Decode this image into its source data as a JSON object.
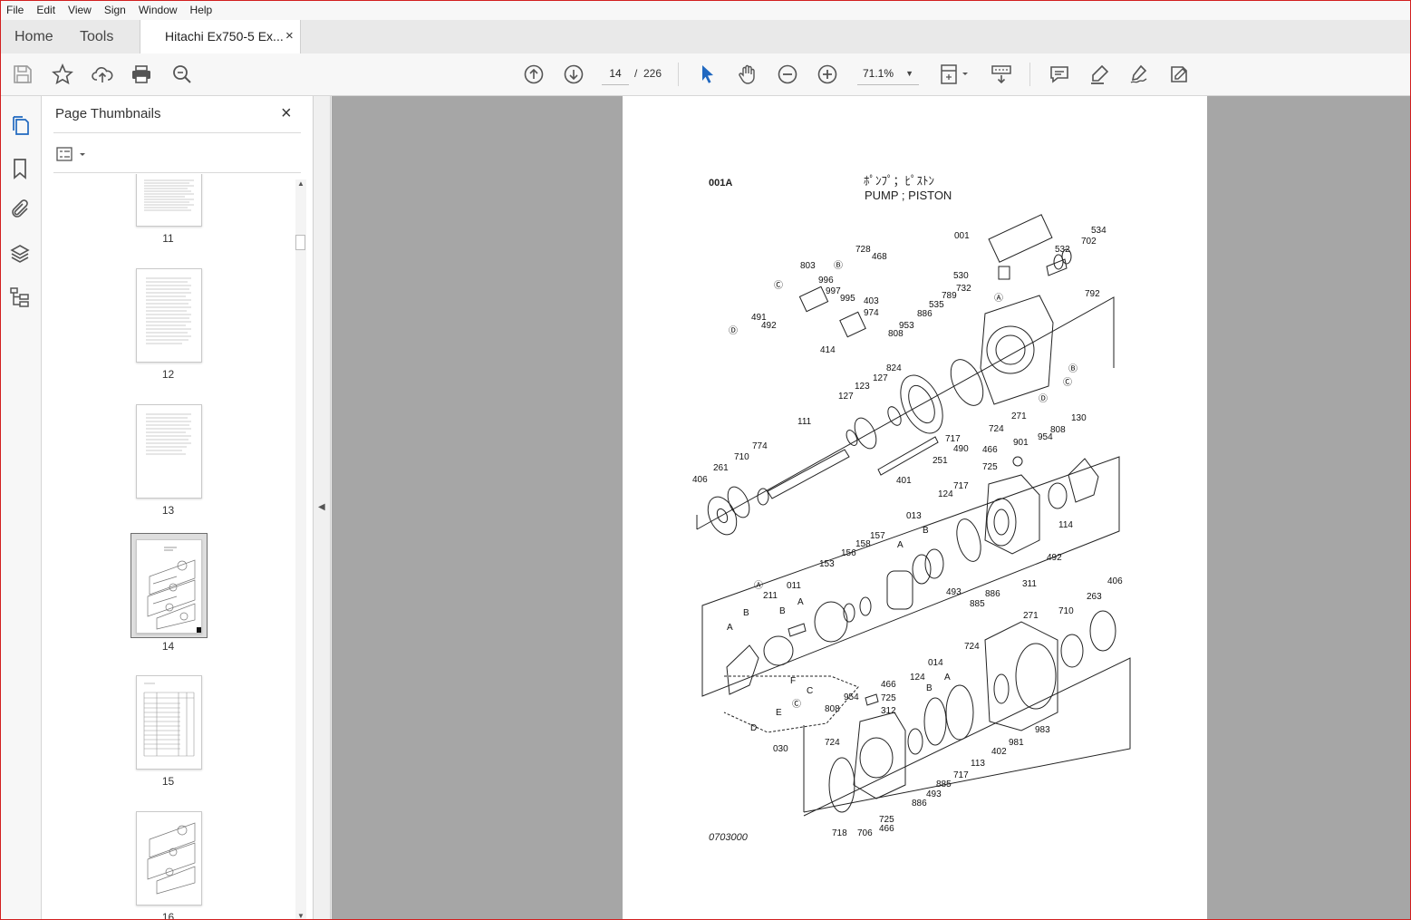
{
  "menu": [
    "File",
    "Edit",
    "View",
    "Sign",
    "Window",
    "Help"
  ],
  "tabs": {
    "home": "Home",
    "tools": "Tools",
    "document": "Hitachi Ex750-5 Ex...",
    "close_glyph": "×"
  },
  "toolbar": {
    "current_page": "14",
    "separator": "/",
    "total_pages": "226",
    "zoom": "71.1%"
  },
  "sidebar": {
    "title": "Page Thumbnails",
    "close_glyph": "×",
    "thumbnails": [
      {
        "label": "11"
      },
      {
        "label": "12"
      },
      {
        "label": "13"
      },
      {
        "label": "14",
        "selected": true
      },
      {
        "label": "15"
      },
      {
        "label": "16"
      }
    ]
  },
  "document": {
    "code": "001A",
    "title_jp": "ﾎﾟﾝﾌﾟ；ﾋﾟｽﾄﾝ",
    "title_en": "PUMP ; PISTON",
    "footer": "0703000",
    "callouts": {
      "group1": [
        "001",
        "728",
        "468",
        "803",
        "996",
        "997",
        "995",
        "403",
        "974",
        "414",
        "491",
        "492",
        "534",
        "702",
        "532",
        "792",
        "530",
        "789",
        "732",
        "535",
        "886",
        "953",
        "808",
        "824",
        "127",
        "123",
        "127",
        "111",
        "774",
        "710",
        "261",
        "406",
        "251",
        "401",
        "490",
        "717",
        "724",
        "271"
      ],
      "group2": [
        "466",
        "901",
        "954",
        "808",
        "130",
        "725",
        "124",
        "717",
        "013",
        "157",
        "158",
        "156",
        "153",
        "114",
        "492",
        "493",
        "885",
        "886",
        "311",
        "011",
        "211",
        "406",
        "263",
        "710",
        "271"
      ],
      "group3": [
        "724",
        "014",
        "466",
        "725",
        "954",
        "312",
        "808",
        "124",
        "724",
        "113",
        "885",
        "493",
        "886",
        "717",
        "981",
        "402",
        "983",
        "718",
        "706",
        "725",
        "466",
        "030"
      ],
      "letters": [
        "A",
        "B",
        "C",
        "D",
        "E",
        "F"
      ]
    }
  },
  "colors": {
    "accent_blue": "#2068c0",
    "frame_red": "#d21f1f",
    "doc_background": "#a6a6a6"
  }
}
